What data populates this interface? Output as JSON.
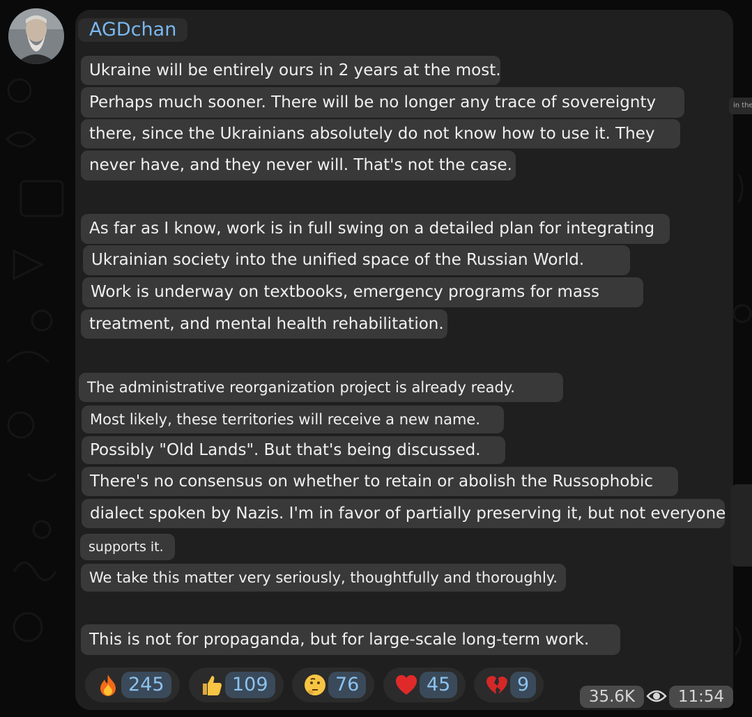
{
  "chat": {
    "sender": "AGDchan",
    "lines": [
      "Ukraine will be entirely ours in 2 years at the most.",
      "Perhaps much sooner. There will be no longer any trace of sovereignty",
      "there, since the Ukrainians absolutely do not know how to use it. They",
      "never have, and they never will. That's not the case.",
      "As far as I know, work is in full swing on a detailed plan for integrating",
      "Ukrainian society into the unified space of the Russian World.",
      "Work is underway on textbooks, emergency programs for mass",
      "treatment, and mental health rehabilitation.",
      "The administrative reorganization project is already ready.",
      "Most likely, these territories will receive a new name.",
      "Possibly \"Old Lands\". But that's being discussed.",
      "There's no consensus on whether to retain or abolish the Russophobic",
      "dialect spoken by Nazis. I'm in favor of partially preserving it, but not everyone",
      "supports it.",
      "We take this matter very seriously, thoughtfully and thoroughly.",
      "This is not for propaganda, but for large-scale long-term work."
    ],
    "reactions": [
      {
        "emoji": "fire-icon",
        "count": "245"
      },
      {
        "emoji": "thumbs-up-icon",
        "count": "109"
      },
      {
        "emoji": "thinking-face-icon",
        "count": "76"
      },
      {
        "emoji": "red-heart-icon",
        "count": "45"
      },
      {
        "emoji": "broken-heart-icon",
        "count": "9"
      }
    ],
    "views": "35.6K",
    "time": "11:54",
    "side_note": "in the"
  },
  "colors": {
    "background": "#0a0a0a",
    "bubble": "#1f1f1f",
    "line_highlight": "#393939",
    "sender_name": "#79b8f0",
    "reaction_count": "#8dc2ee"
  }
}
